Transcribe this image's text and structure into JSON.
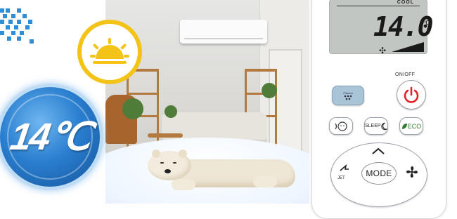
{
  "hero": {
    "temperature_badge": "14℃",
    "weather_icon": "sun-icon",
    "scene": "living-room-with-polar-bear"
  },
  "remote": {
    "display": {
      "mode_text": "COOL",
      "temperature": "14.0",
      "unit": "℃",
      "fan_icon": "fan-icon"
    },
    "on_off_label": "ON/OFF",
    "buttons": {
      "power": "power-icon",
      "top_left_small_text": "Plasma",
      "sleep": "SLEEP",
      "eco": "ECO",
      "mode": "MODE",
      "jet": "JET"
    }
  },
  "colors": {
    "badge_blue": "#2a7fd0",
    "sun_yellow": "#f3c317",
    "power_red": "#e2232a",
    "eco_green": "#2f7d2f",
    "accent_dots": "#2f8fd6"
  }
}
